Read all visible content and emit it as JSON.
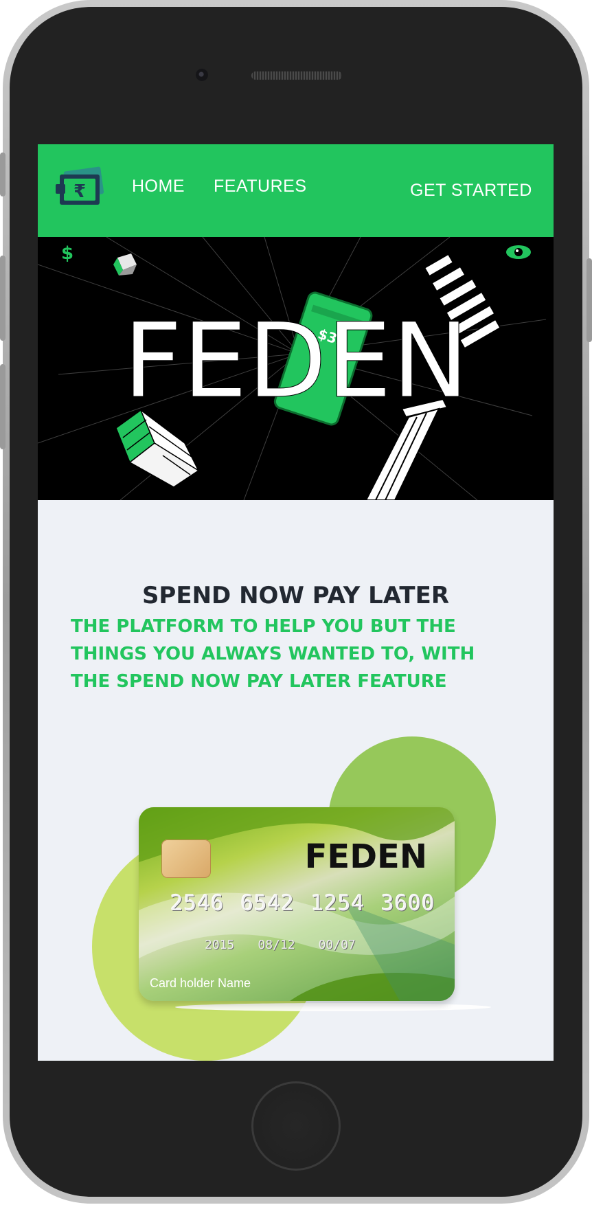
{
  "nav": {
    "home_label": "HOME",
    "features_label": "FEATURES",
    "cta_label": "GET STARTED",
    "logo_icon": "rupee-wallet-icon"
  },
  "hero": {
    "title": "FEDEN",
    "phone_amount": "$35",
    "icons": [
      "dollar-icon",
      "eye-icon"
    ]
  },
  "content": {
    "tagline": "SPEND NOW PAY LATER",
    "description_lines": [
      "THE PLATFORM TO HELP YOU BUT THE",
      "THINGS YOU ALWAYS WANTED TO, WITH",
      "THE SPEND NOW PAY LATER FEATURE"
    ]
  },
  "card": {
    "brand": "FEDEN",
    "number": "2546 6542 1254 3600",
    "dates": [
      "2015",
      "08/12",
      "00/07"
    ],
    "holder": "Card holder Name"
  },
  "colors": {
    "accent_green": "#22c55e",
    "dark_text": "#222831",
    "page_bg": "#eef1f6",
    "circle_green": "#96c85a",
    "circle_lime": "#c7e06a"
  }
}
